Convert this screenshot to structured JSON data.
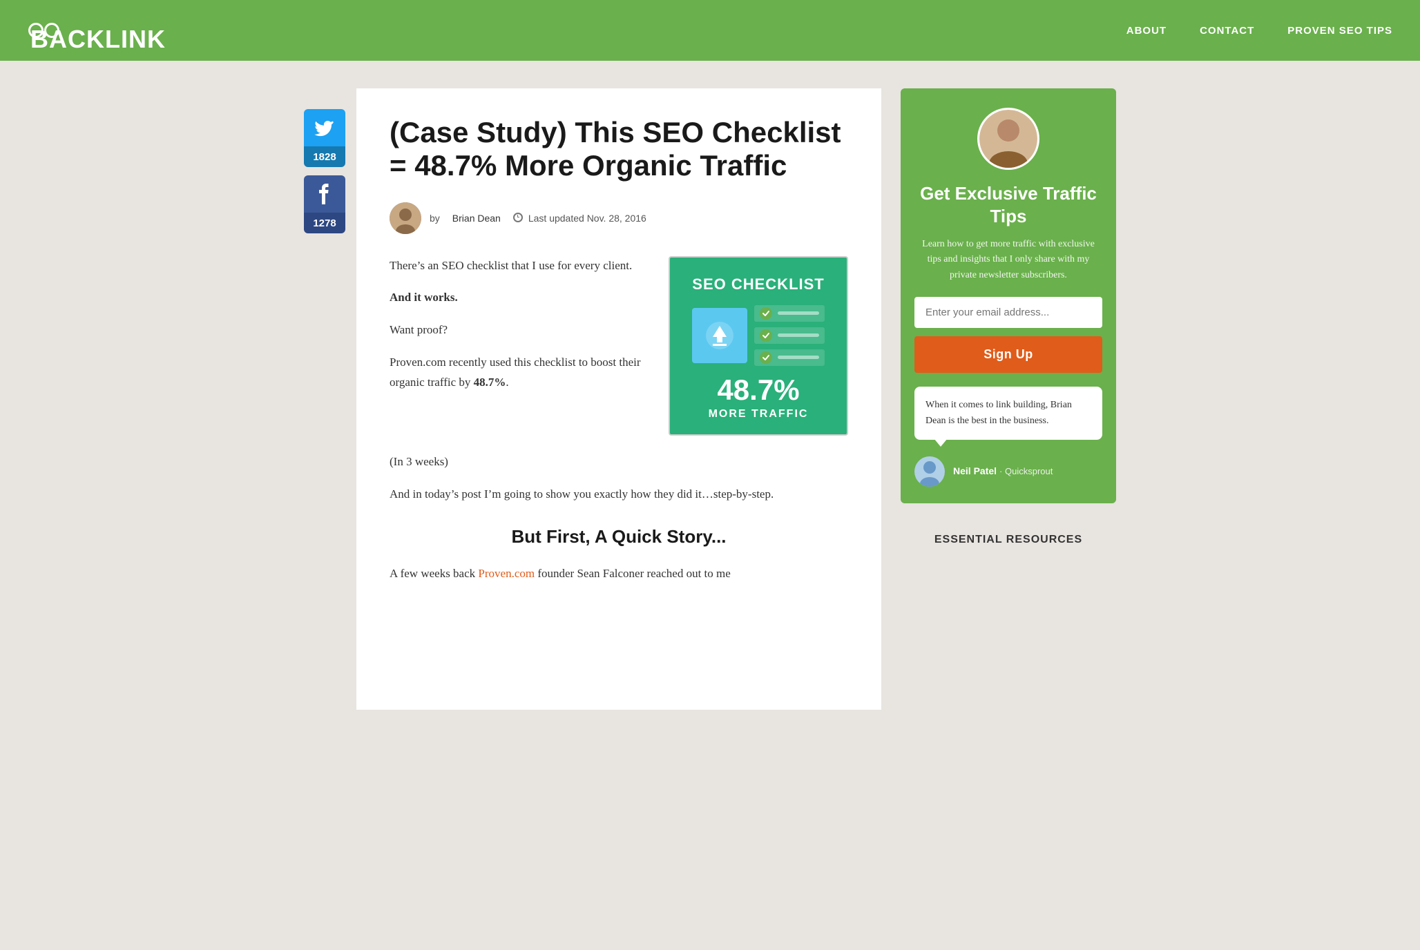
{
  "header": {
    "logo": "BACKLINKO",
    "nav": {
      "about": "ABOUT",
      "contact": "CONTACT",
      "proven_seo": "PROVEN SEO TIPS"
    }
  },
  "social": {
    "twitter": {
      "count": "1828"
    },
    "facebook": {
      "count": "1278"
    }
  },
  "article": {
    "title": "(Case Study) This SEO Checklist = 48.7% More Organic Traffic",
    "author": "Brian Dean",
    "date_label": "Last updated Nov. 28, 2016",
    "intro_p1": "There’s an SEO checklist that I use for every client.",
    "bold_line": "And it works.",
    "proof_line": "Want proof?",
    "intro_p2": "Proven.com recently used this checklist to boost their organic traffic by ",
    "bold_percent": "48.7%",
    "intro_p2_end": ".",
    "in_3_weeks": "(In 3 weeks)",
    "intro_p3": "And in today’s post I’m going to show you exactly how they did it…step-by-step.",
    "subheading": "But First, A Quick Story...",
    "teaser": "A few weeks back Proven.com founder Sean Falconer reached out to me",
    "seo_checklist_box": {
      "title": "SEO CHECKLIST",
      "percent": "48.7%",
      "more_traffic": "MORE TRAFFIC"
    }
  },
  "sidebar": {
    "widget": {
      "title": "Get Exclusive Traffic Tips",
      "description": "Learn how to get more traffic with exclusive tips and insights that I only share with my private newsletter subscribers.",
      "email_placeholder": "Enter your email address...",
      "signup_button": "Sign Up",
      "testimonial": {
        "quote": "When it comes to link building, Brian Dean is the best in the business.",
        "author": "Neil Patel",
        "company": "Quicksprout"
      }
    },
    "essential_resources": {
      "title": "ESSENTIAL RESOURCES"
    }
  },
  "colors": {
    "green": "#6ab04c",
    "orange": "#e05c1a",
    "twitter_blue": "#1da1f2",
    "facebook_blue": "#3b5998",
    "seo_green": "#2ab07a"
  }
}
